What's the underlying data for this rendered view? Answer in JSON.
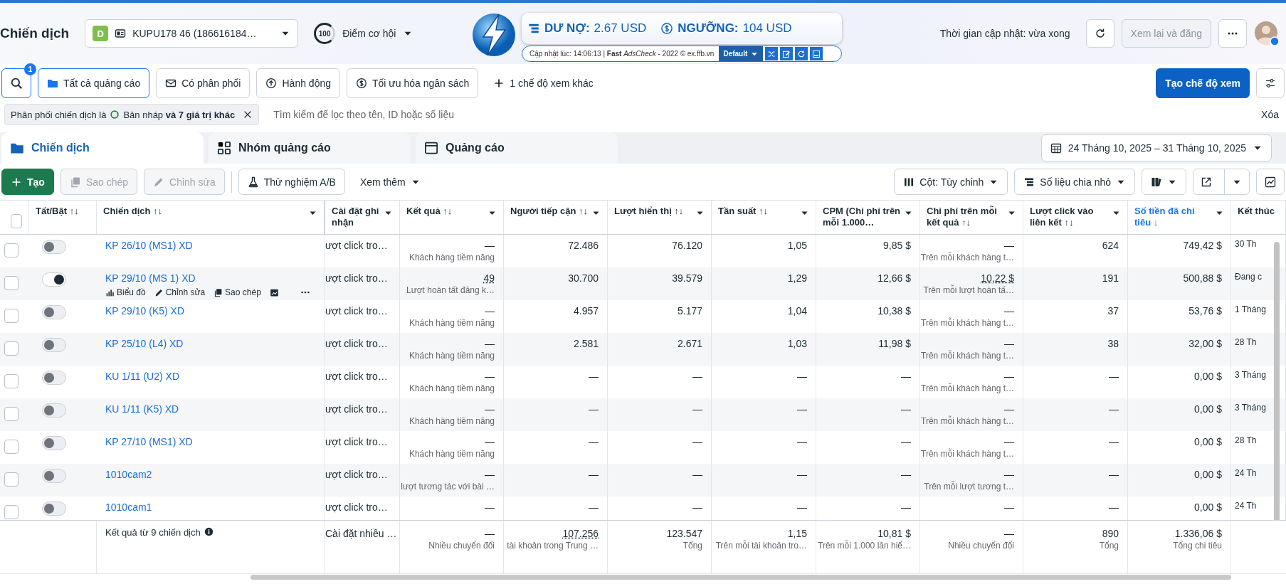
{
  "header": {
    "title": "Chiến dịch",
    "account": {
      "badge": "D",
      "name": "KUPU178 46 (186616184…"
    },
    "score": {
      "value": "100",
      "label": "Điểm cơ hội"
    },
    "update_status": "Thời gian cập nhật: vừa xong",
    "review_button": {
      "label": "Xem lại và đăng",
      "disabled": true
    }
  },
  "extension": {
    "debt_label": "DƯ NỢ:",
    "debt": "2.67 USD",
    "threshold_label": "NGƯỠNG:",
    "threshold": "104 USD",
    "footer": "Cập nhật lúc: 14:06:13 | **Fast** *AdsCheck* - 2022 © ex.ffb.vn",
    "profile": "Default"
  },
  "views": {
    "search_badge": "1",
    "items": [
      {
        "label": "Tất cả quảng cáo",
        "selected": true
      },
      {
        "label": "Có phân phối",
        "selected": false
      },
      {
        "label": "Hành động",
        "selected": false
      },
      {
        "label": "Tối ưu hóa ngân sách",
        "selected": false
      }
    ],
    "more": "1 chế độ xem khác",
    "create_view": "Tạo chế độ xem"
  },
  "filter": {
    "chip_prefix": "Phân phối chiến dịch là",
    "chip_value": "Bản nháp **và 7 giá trị khác**",
    "search_placeholder": "Tìm kiếm để lọc theo tên, ID hoặc số liệu",
    "clear": "Xóa"
  },
  "level_tabs": [
    {
      "label": "Chiến dịch",
      "selected": true
    },
    {
      "label": "Nhóm quảng cáo",
      "selected": false
    },
    {
      "label": "Quảng cáo",
      "selected": false
    }
  ],
  "date_range": "24 Tháng 10, 2025 – 31 Tháng 10, 2025",
  "toolbar": {
    "left": [
      {
        "label": "Tạo",
        "kind": "primary",
        "disabled": false
      },
      {
        "label": "Sao chép",
        "kind": "plain",
        "disabled": true
      },
      {
        "label": "Chỉnh sửa",
        "kind": "plain",
        "disabled": true
      },
      {
        "label": "Thử nghiệm A/B",
        "kind": "plain",
        "disabled": false
      },
      {
        "label": "Xem thêm",
        "kind": "menu",
        "disabled": false
      }
    ],
    "right": [
      {
        "label": "Cột: Tùy chỉnh"
      },
      {
        "label": "Số liệu chia nhỏ"
      }
    ]
  },
  "table": {
    "all_checked": false,
    "columns": [
      {
        "label": "Tất/Bật ↑↓",
        "has_menu": false,
        "sorted": false
      },
      {
        "label": "Chiến dịch ↑↓",
        "has_menu": true,
        "sorted": false
      },
      {
        "label": "Cài đặt ghi nhận",
        "has_menu": true,
        "sorted": false
      },
      {
        "label": "Kết quả ↑↓",
        "has_menu": true,
        "sorted": false
      },
      {
        "label": "Người tiếp cận ↑↓",
        "has_menu": true,
        "sorted": false
      },
      {
        "label": "Lượt hiển thị ↑↓",
        "has_menu": true,
        "sorted": false
      },
      {
        "label": "Tần suất ↑↓",
        "has_menu": true,
        "sorted": false
      },
      {
        "label": "CPM (Chi phí trên mỗi 1.000…",
        "has_menu": true,
        "sorted": false
      },
      {
        "label": "Chi phí trên mỗi kết quả ↑↓",
        "has_menu": true,
        "sorted": false
      },
      {
        "label": "Lượt click vào liên kết ↑↓",
        "has_menu": true,
        "sorted": false
      },
      {
        "label": "Số tiền đã chi tiêu ↓",
        "has_menu": true,
        "sorted": true
      },
      {
        "label": "Kết thúc",
        "has_menu": false,
        "sorted": false
      }
    ],
    "rows": [
      {
        "name": "KP 26/10 (MS1) XD",
        "checked": false,
        "active": false,
        "attribution": "ượt click tro…",
        "results": {
          "value": "—",
          "sub": "Khách hàng tiềm năng",
          "linked": false
        },
        "reach": "72.486",
        "impressions": "76.120",
        "frequency": "1,05",
        "cpm": "9,85 $",
        "cost_per_result": {
          "value": "—",
          "sub": "Trên mỗi khách hàng t…",
          "linked": false
        },
        "link_clicks": "624",
        "spent": "749,42 $",
        "end": "30 Th"
      },
      {
        "name": "KP 29/10 (MS 1) XD",
        "checked": false,
        "active": true,
        "actions": [
          "Biểu đồ",
          "Chỉnh sửa",
          "Sao chép"
        ],
        "attribution": "ượt click tro…",
        "results": {
          "value": "49",
          "sub": "Lượt hoàn tất đăng k…",
          "linked": true
        },
        "reach": "30.700",
        "impressions": "39.579",
        "frequency": "1,29",
        "cpm": "12,66 $",
        "cost_per_result": {
          "value": "10,22 $",
          "sub": "Trên mỗi lượt hoàn tấ…",
          "linked": true
        },
        "link_clicks": "191",
        "spent": "500,88 $",
        "end": "Đang c"
      },
      {
        "name": "KP 29/10 (K5) XD",
        "checked": false,
        "active": false,
        "attribution": "ượt click tro…",
        "results": {
          "value": "—",
          "sub": "Khách hàng tiềm năng",
          "linked": false
        },
        "reach": "4.957",
        "impressions": "5.177",
        "frequency": "1,04",
        "cpm": "10,38 $",
        "cost_per_result": {
          "value": "—",
          "sub": "Trên mỗi khách hàng t…",
          "linked": false
        },
        "link_clicks": "37",
        "spent": "53,76 $",
        "end": "1 Tháng"
      },
      {
        "name": "KP 25/10 (L4) XD",
        "checked": false,
        "active": false,
        "attribution": "ượt click tro…",
        "results": {
          "value": "—",
          "sub": "Khách hàng tiềm năng",
          "linked": false
        },
        "reach": "2.581",
        "impressions": "2.671",
        "frequency": "1,03",
        "cpm": "11,98 $",
        "cost_per_result": {
          "value": "—",
          "sub": "Trên mỗi khách hàng t…",
          "linked": false
        },
        "link_clicks": "38",
        "spent": "32,00 $",
        "end": "28 Th"
      },
      {
        "name": "KU 1/11 (U2) XD",
        "checked": false,
        "active": false,
        "attribution": "ượt click tro…",
        "results": {
          "value": "—",
          "sub": "Khách hàng tiềm năng",
          "linked": false
        },
        "reach": "—",
        "impressions": "—",
        "frequency": "—",
        "cpm": "—",
        "cost_per_result": {
          "value": "—",
          "sub": "Trên mỗi khách hàng t…",
          "linked": false
        },
        "link_clicks": "—",
        "spent": "0,00 $",
        "end": "3 Tháng"
      },
      {
        "name": "KU 1/11 (K5) XD",
        "checked": false,
        "active": false,
        "attribution": "ượt click tro…",
        "results": {
          "value": "—",
          "sub": "Khách hàng tiềm năng",
          "linked": false
        },
        "reach": "—",
        "impressions": "—",
        "frequency": "—",
        "cpm": "—",
        "cost_per_result": {
          "value": "—",
          "sub": "Trên mỗi khách hàng t…",
          "linked": false
        },
        "link_clicks": "—",
        "spent": "0,00 $",
        "end": "3 Tháng"
      },
      {
        "name": "KP 27/10 (MS1) XD",
        "checked": false,
        "active": false,
        "attribution": "ượt click tro…",
        "results": {
          "value": "—",
          "sub": "Khách hàng tiềm năng",
          "linked": false
        },
        "reach": "—",
        "impressions": "—",
        "frequency": "—",
        "cpm": "—",
        "cost_per_result": {
          "value": "—",
          "sub": "Trên mỗi khách hàng t…",
          "linked": false
        },
        "link_clicks": "—",
        "spent": "0,00 $",
        "end": "28 Th"
      },
      {
        "name": "1010cam2",
        "checked": false,
        "active": false,
        "attribution": "ượt click tro…",
        "results": {
          "value": "—",
          "sub": "lượt tương tác với bài …",
          "linked": false
        },
        "reach": "—",
        "impressions": "—",
        "frequency": "—",
        "cpm": "—",
        "cost_per_result": {
          "value": "—",
          "sub": "Trên mỗi lượt tương t…",
          "linked": false
        },
        "link_clicks": "—",
        "spent": "0,00 $",
        "end": "24 Th"
      },
      {
        "name": "1010cam1",
        "checked": false,
        "active": false,
        "attribution": "ượt click tro…",
        "results": {
          "value": "—",
          "linked": false
        },
        "reach": "—",
        "impressions": "—",
        "frequency": "—",
        "cpm": "—",
        "cost_per_result": {
          "value": "—",
          "linked": false
        },
        "link_clicks": "—",
        "spent": "0,00 $",
        "end": "24 Th"
      }
    ],
    "footer": {
      "summary": "Kết quả từ 9 chiến dịch",
      "attribution": "Cài đặt nhiều …",
      "results": {
        "value": "—",
        "sub": "Nhiều chuyển đổi",
        "linked": false
      },
      "reach": {
        "value": "107.256",
        "sub": "tài khoản trong Trung …",
        "linked": true
      },
      "impressions": {
        "value": "123.547",
        "sub": "Tổng",
        "linked": false
      },
      "frequency": {
        "value": "1,15",
        "sub": "Trên mỗi tài khoản tro…",
        "linked": false
      },
      "cpm": {
        "value": "10,81 $",
        "sub": "Trên mỗi 1.000 lần hiể…",
        "linked": false
      },
      "cost_per_result": {
        "value": "—",
        "sub": "Nhiều chuyển đổi",
        "linked": false
      },
      "link_clicks": {
        "value": "890",
        "sub": "Tổng",
        "linked": false
      },
      "spent": {
        "value": "1.336,06 $",
        "sub": "Tổng chi tiêu",
        "linked": false
      }
    }
  }
}
